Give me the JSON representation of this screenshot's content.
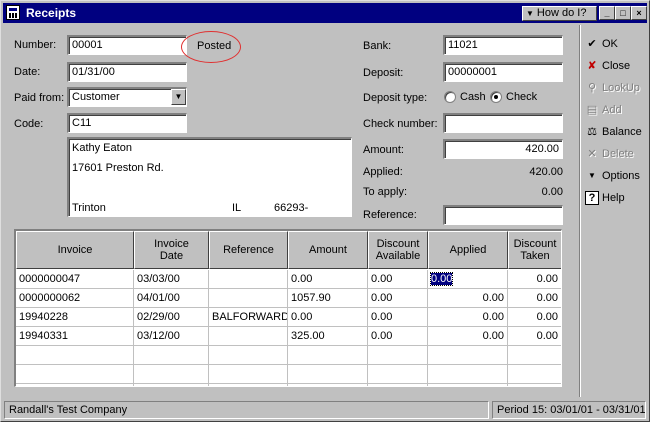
{
  "window": {
    "title": "Receipts",
    "howdo_label": "How do I?",
    "min_glyph": "_",
    "max_glyph": "□",
    "close_glyph": "×"
  },
  "form": {
    "number_label": "Number:",
    "number_value": "00001",
    "status_text": "Posted",
    "date_label": "Date:",
    "date_value": "01/31/00",
    "paid_from_label": "Paid from:",
    "paid_from_value": "Customer",
    "code_label": "Code:",
    "code_value": "C11",
    "address": {
      "name": "Kathy Eaton",
      "street": "17601 Preston Rd.",
      "city": "Trinton",
      "state": "IL",
      "zip": "66293-"
    },
    "bank_label": "Bank:",
    "bank_value": "11021",
    "deposit_label": "Deposit:",
    "deposit_value": "00000001",
    "deposit_type_label": "Deposit type:",
    "deposit_type_options": [
      "Cash",
      "Check"
    ],
    "deposit_type_selected": "Check",
    "check_number_label": "Check number:",
    "check_number_value": "",
    "amount_label": "Amount:",
    "amount_value": "420.00",
    "applied_label": "Applied:",
    "applied_value": "420.00",
    "to_apply_label": "To apply:",
    "to_apply_value": "0.00",
    "reference_label": "Reference:",
    "reference_value": ""
  },
  "grid": {
    "headers": {
      "invoice": "Invoice",
      "invoice_date_1": "Invoice",
      "invoice_date_2": "Date",
      "reference": "Reference",
      "amount": "Amount",
      "discount_available_1": "Discount",
      "discount_available_2": "Available",
      "applied": "Applied",
      "discount_taken_1": "Discount",
      "discount_taken_2": "Taken"
    },
    "rows": [
      {
        "invoice": "0000000047",
        "date": "03/03/00",
        "reference": "",
        "amount": "0.00",
        "discount_available": "0.00",
        "applied": "0.00",
        "discount_taken": "0.00"
      },
      {
        "invoice": "0000000062",
        "date": "04/01/00",
        "reference": "",
        "amount": "1057.90",
        "discount_available": "0.00",
        "applied": "0.00",
        "discount_taken": "0.00"
      },
      {
        "invoice": "19940228",
        "date": "02/29/00",
        "reference": "BALFORWARD",
        "amount": "0.00",
        "discount_available": "0.00",
        "applied": "0.00",
        "discount_taken": "0.00"
      },
      {
        "invoice": "19940331",
        "date": "03/12/00",
        "reference": "",
        "amount": "325.00",
        "discount_available": "0.00",
        "applied": "0.00",
        "discount_taken": "0.00"
      }
    ]
  },
  "toolbar": {
    "ok": "OK",
    "close": "Close",
    "lookup": "LookUp",
    "add": "Add",
    "balance": "Balance",
    "delete": "Delete",
    "options": "Options",
    "help": "Help"
  },
  "status": {
    "company": "Randall's Test Company",
    "period": "Period 15: 03/01/01 - 03/31/01"
  },
  "colors": {
    "titlebar": "#000080",
    "face": "#c0c0c0",
    "posted_circle": "#e03030"
  }
}
